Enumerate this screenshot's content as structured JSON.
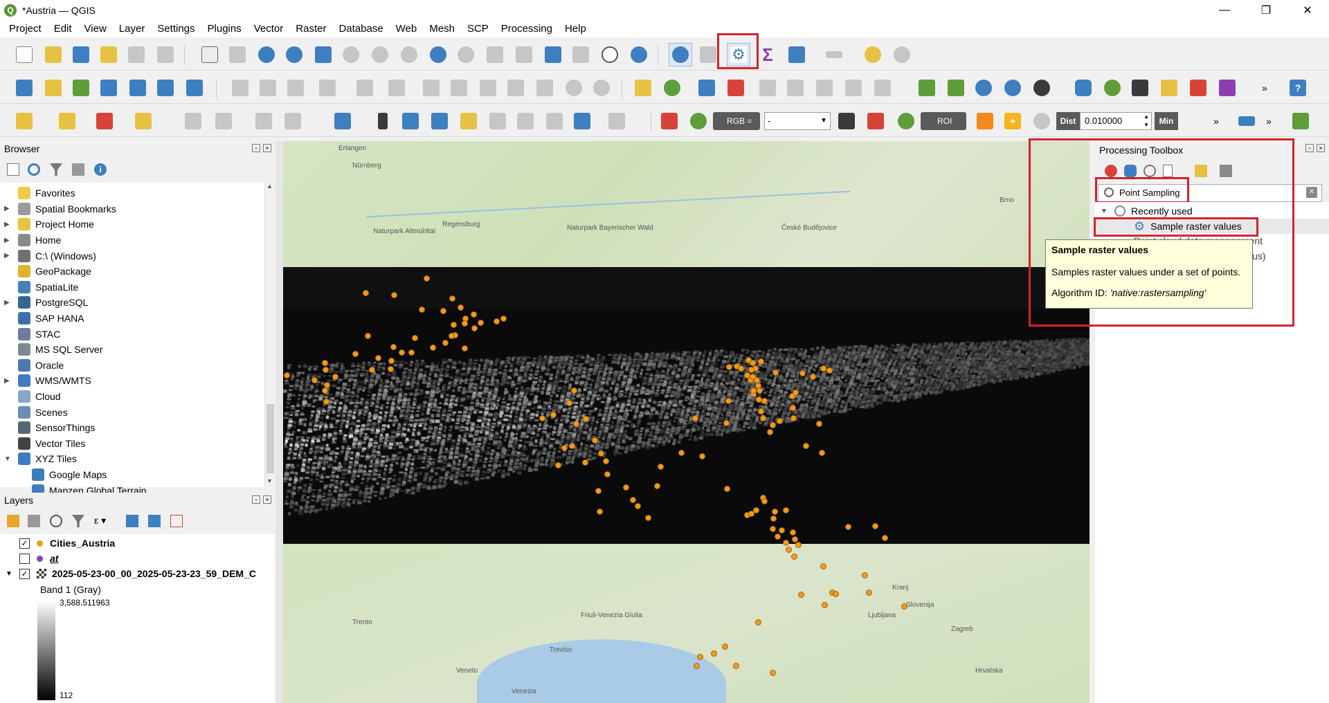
{
  "window": {
    "title": "*Austria — QGIS",
    "app_icon": "Q",
    "minimize": "—",
    "maximize": "❐",
    "close": "✕"
  },
  "menu": [
    "Project",
    "Edit",
    "View",
    "Layer",
    "Settings",
    "Plugins",
    "Vector",
    "Raster",
    "Database",
    "Web",
    "Mesh",
    "SCP",
    "Processing",
    "Help"
  ],
  "toolbar3": {
    "rgb_label": "RGB =",
    "band_value": "-",
    "roi_label": "ROI",
    "dist_label": "Dist",
    "dist_value": "0.010000",
    "min_label": "Min",
    "overflow": "»"
  },
  "browser": {
    "title": "Browser",
    "items": [
      {
        "label": "Favorites",
        "icon": "star-icon",
        "color": "#f2c94c",
        "arrow": ""
      },
      {
        "label": "Spatial Bookmarks",
        "icon": "bookmark-icon",
        "color": "#9a9a9a",
        "arrow": "▶"
      },
      {
        "label": "Project Home",
        "icon": "folder-icon",
        "color": "#e7c142",
        "arrow": "▶"
      },
      {
        "label": "Home",
        "icon": "home-icon",
        "color": "#8a8a8a",
        "arrow": "▶"
      },
      {
        "label": "C:\\ (Windows)",
        "icon": "drive-icon",
        "color": "#6f6f6f",
        "arrow": "▶"
      },
      {
        "label": "GeoPackage",
        "icon": "geopackage-icon",
        "color": "#e1b22c",
        "arrow": ""
      },
      {
        "label": "SpatiaLite",
        "icon": "spatialite-icon",
        "color": "#4a7fb5",
        "arrow": ""
      },
      {
        "label": "PostgreSQL",
        "icon": "postgresql-icon",
        "color": "#336791",
        "arrow": "▶"
      },
      {
        "label": "SAP HANA",
        "icon": "saphana-icon",
        "color": "#3d6fb0",
        "arrow": ""
      },
      {
        "label": "STAC",
        "icon": "stac-icon",
        "color": "#6e7c9e",
        "arrow": ""
      },
      {
        "label": "MS SQL Server",
        "icon": "mssql-icon",
        "color": "#808890",
        "arrow": ""
      },
      {
        "label": "Oracle",
        "icon": "oracle-icon",
        "color": "#4c78b0",
        "arrow": ""
      },
      {
        "label": "WMS/WMTS",
        "icon": "wms-icon",
        "color": "#3e7cc0",
        "arrow": "▶"
      },
      {
        "label": "Cloud",
        "icon": "cloud-icon",
        "color": "#8aa5c8",
        "arrow": ""
      },
      {
        "label": "Scenes",
        "icon": "scenes-icon",
        "color": "#6b8db5",
        "arrow": ""
      },
      {
        "label": "SensorThings",
        "icon": "sensor-icon",
        "color": "#556677",
        "arrow": ""
      },
      {
        "label": "Vector Tiles",
        "icon": "vector-tiles-icon",
        "color": "#444",
        "arrow": ""
      },
      {
        "label": "XYZ Tiles",
        "icon": "xyz-tiles-icon",
        "color": "#3e7cc0",
        "arrow": "▼"
      },
      {
        "label": "Google Maps",
        "icon": "tiles-icon",
        "color": "#3e7cc0",
        "arrow": "",
        "indent": true
      },
      {
        "label": "Mapzen Global Terrain",
        "icon": "tiles-icon",
        "color": "#3e7cc0",
        "arrow": "",
        "indent": true
      }
    ]
  },
  "layers": {
    "title": "Layers",
    "items": [
      {
        "label": "Cities_Austria",
        "checked": "✓",
        "bold": true,
        "italic": false,
        "color": "#f29b1b",
        "arrow": ""
      },
      {
        "label": "at",
        "checked": "",
        "bold": true,
        "italic": true,
        "color": "#8b3fb0",
        "arrow": ""
      },
      {
        "label": "2025-05-23-00_00_2025-05-23-23_59_DEM_C",
        "checked": "✓",
        "bold": true,
        "italic": false,
        "color": "#333",
        "arrow": "▼"
      }
    ],
    "band": "Band 1 (Gray)",
    "legend_max": "3,588.511963",
    "legend_min": "112"
  },
  "map_labels": [
    "Nürnberg",
    "Regensburg",
    "Naturpark Altmühltal",
    "Naturpark Bayerischer Wald",
    "Brno",
    "České Budějovice",
    "Kranj",
    "Slovenija",
    "Ljubljana",
    "Zagreb",
    "Trento",
    "Treviso",
    "Venezia",
    "Friuli-Venezia Giulia",
    "Erlangen",
    "Veneto",
    "Hrvatska"
  ],
  "toolbox": {
    "title": "Processing Toolbox",
    "search_value": "Point Sampling",
    "recently_used": "Recently used",
    "algorithm": "Sample raster values",
    "hidden_group": "Point cloud data management",
    "hidden_item": "ius)",
    "clear": "✕"
  },
  "tooltip": {
    "title": "Sample raster values",
    "description": "Samples raster values under a set of points.",
    "id_label": "Algorithm ID: ",
    "id_value": "'native:rastersampling'"
  },
  "colors": {
    "accent_red": "#d2232a",
    "qgis_green": "#589632",
    "city_orange": "#f29b1b"
  }
}
